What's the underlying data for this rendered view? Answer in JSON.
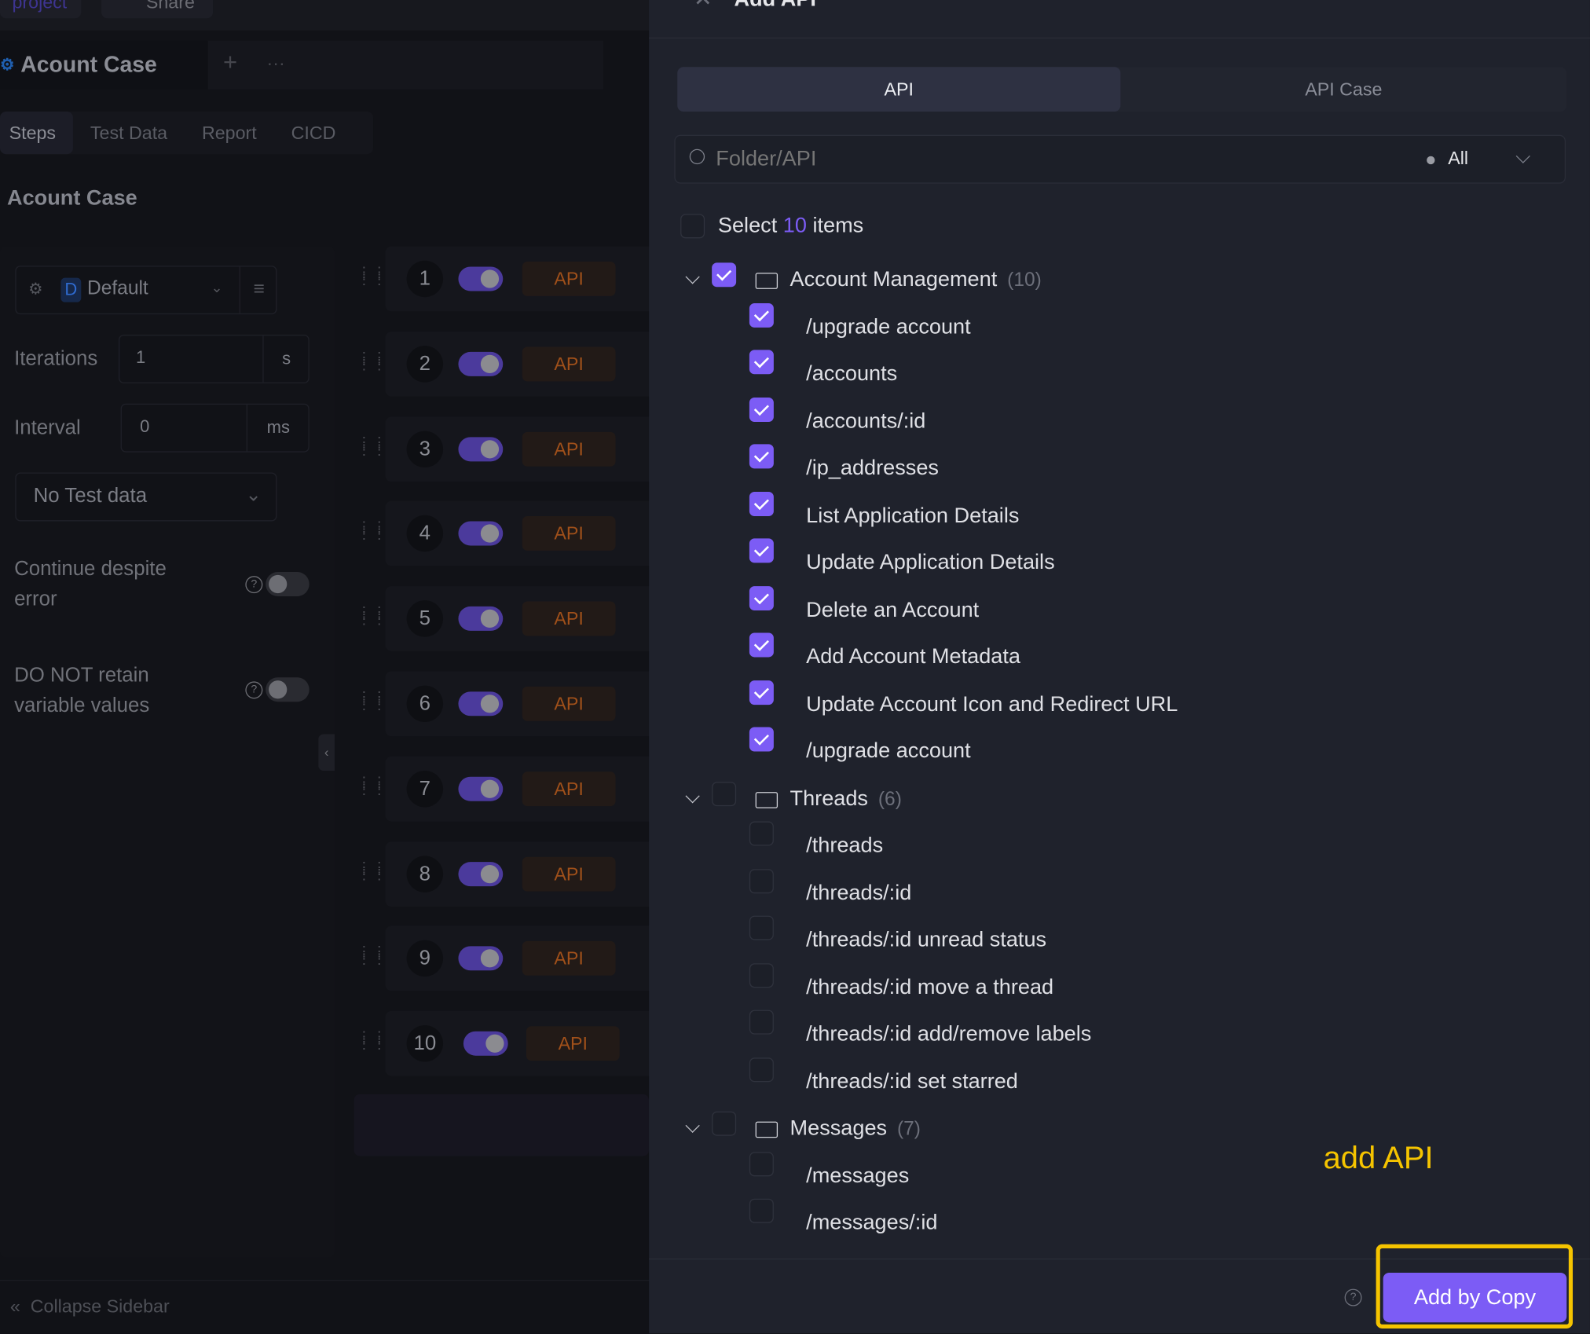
{
  "topbar": {
    "project_tab": "project",
    "share_label": "Share"
  },
  "case_tab": {
    "title": "Acount Case",
    "add": "+",
    "more": "···"
  },
  "tabs": [
    {
      "label": "Steps",
      "active": true
    },
    {
      "label": "Test Data"
    },
    {
      "label": "Report"
    },
    {
      "label": "CICD"
    }
  ],
  "heading": "Acount Case",
  "settings": {
    "environment": {
      "badge": "D",
      "value": "Default"
    },
    "iterations": {
      "label": "Iterations",
      "value": "1",
      "unit": "s"
    },
    "interval": {
      "label": "Interval",
      "value": "0",
      "unit": "ms"
    },
    "test_data": "No Test data",
    "continue_error": {
      "label": "Continue despite error",
      "line1": "Continue despite",
      "line2": "error",
      "enabled": false
    },
    "retain_vars": {
      "label": "DO NOT retain variable values",
      "line1": "DO NOT retain",
      "line2": "variable values",
      "enabled": false
    }
  },
  "steps": [
    {
      "n": "1",
      "type": "API",
      "enabled": true
    },
    {
      "n": "2",
      "type": "API",
      "enabled": true
    },
    {
      "n": "3",
      "type": "API",
      "enabled": true
    },
    {
      "n": "4",
      "type": "API",
      "enabled": true
    },
    {
      "n": "5",
      "type": "API",
      "enabled": true
    },
    {
      "n": "6",
      "type": "API",
      "enabled": true
    },
    {
      "n": "7",
      "type": "API",
      "enabled": true
    },
    {
      "n": "8",
      "type": "API",
      "enabled": true
    },
    {
      "n": "9",
      "type": "API",
      "enabled": true
    },
    {
      "n": "10",
      "type": "API",
      "enabled": true
    }
  ],
  "collapse_sidebar": "Collapse Sidebar",
  "drawer": {
    "title": "Add API",
    "segments": [
      {
        "label": "API",
        "active": true
      },
      {
        "label": "API Case"
      }
    ],
    "search_placeholder": "Folder/API",
    "filter": "All",
    "select_prefix": "Select",
    "select_count": "10",
    "select_suffix": "items",
    "folders": [
      {
        "name": "Account Management",
        "count": "(10)",
        "checked": true,
        "items": [
          {
            "label": "/upgrade account",
            "checked": true
          },
          {
            "label": "/accounts",
            "checked": true
          },
          {
            "label": "/accounts/:id",
            "checked": true
          },
          {
            "label": "/ip_addresses",
            "checked": true
          },
          {
            "label": "List Application Details",
            "checked": true
          },
          {
            "label": "Update Application Details",
            "checked": true
          },
          {
            "label": "Delete an Account",
            "checked": true
          },
          {
            "label": "Add Account Metadata",
            "checked": true
          },
          {
            "label": "Update Account Icon and Redirect URL",
            "checked": true
          },
          {
            "label": "/upgrade account",
            "checked": true
          }
        ]
      },
      {
        "name": "Threads",
        "count": "(6)",
        "checked": false,
        "items": [
          {
            "label": "/threads",
            "checked": false
          },
          {
            "label": "/threads/:id",
            "checked": false
          },
          {
            "label": "/threads/:id unread status",
            "checked": false
          },
          {
            "label": "/threads/:id move a thread",
            "checked": false
          },
          {
            "label": "/threads/:id add/remove labels",
            "checked": false
          },
          {
            "label": "/threads/:id set starred",
            "checked": false
          }
        ]
      },
      {
        "name": "Messages",
        "count": "(7)",
        "checked": false,
        "items": [
          {
            "label": "/messages",
            "checked": false
          },
          {
            "label": "/messages/:id",
            "checked": false
          }
        ]
      }
    ],
    "submit": "Add by Copy"
  },
  "annotation": {
    "text": "add API",
    "color": "#f5c400"
  },
  "colors": {
    "accent": "#7c5cf5",
    "api_badge": "#a0501a"
  }
}
